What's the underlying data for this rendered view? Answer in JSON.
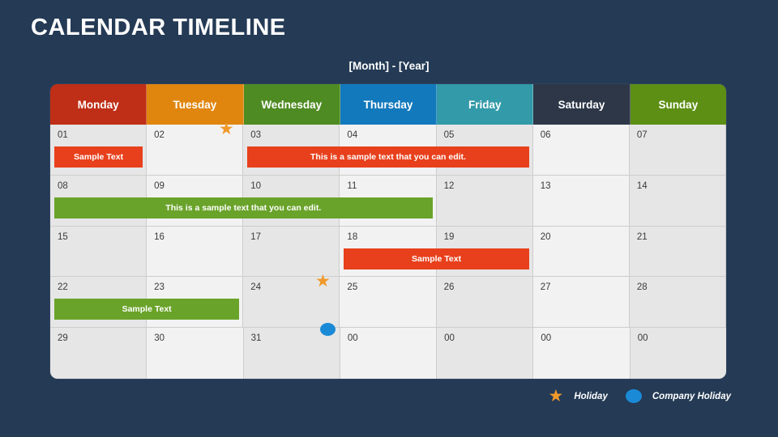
{
  "page": {
    "title": "CALENDAR TIMELINE",
    "subtitle": "[Month] - [Year]",
    "background_color": "#243a55"
  },
  "header": {
    "days": [
      {
        "label": "Monday",
        "color": "#bf2e16"
      },
      {
        "label": "Tuesday",
        "color": "#e0860f"
      },
      {
        "label": "Wednesday",
        "color": "#4e8b22"
      },
      {
        "label": "Thursday",
        "color": "#1379bd"
      },
      {
        "label": "Friday",
        "color": "#329aa8"
      },
      {
        "label": "Saturday",
        "color": "#2d3748"
      },
      {
        "label": "Sunday",
        "color": "#5d8f14"
      }
    ]
  },
  "weeks": [
    {
      "days": [
        "01",
        "02",
        "03",
        "04",
        "05",
        "06",
        "07"
      ],
      "markers": [
        {
          "day_index": 1,
          "type": "star",
          "icon": "star-icon"
        }
      ],
      "events": [
        {
          "text": "Sample Text",
          "start": 0,
          "span": 1,
          "color": "red"
        },
        {
          "text": "This is a sample text that you can edit.",
          "start": 2,
          "span": 3,
          "color": "red"
        }
      ]
    },
    {
      "days": [
        "08",
        "09",
        "10",
        "11",
        "12",
        "13",
        "14"
      ],
      "markers": [],
      "events": [
        {
          "text": "This is a sample text that you can edit.",
          "start": 0,
          "span": 4,
          "color": "green"
        }
      ]
    },
    {
      "days": [
        "15",
        "16",
        "17",
        "18",
        "19",
        "20",
        "21"
      ],
      "markers": [],
      "events": [
        {
          "text": "Sample Text",
          "start": 3,
          "span": 2,
          "color": "red"
        }
      ]
    },
    {
      "days": [
        "22",
        "23",
        "24",
        "25",
        "26",
        "27",
        "28"
      ],
      "markers": [
        {
          "day_index": 2,
          "type": "star",
          "icon": "star-icon"
        }
      ],
      "events": [
        {
          "text": "Sample Text",
          "start": 0,
          "span": 2,
          "color": "green"
        }
      ]
    },
    {
      "days": [
        "29",
        "30",
        "31",
        "00",
        "00",
        "00",
        "00"
      ],
      "markers": [
        {
          "day_index": 2,
          "type": "dot",
          "icon": "circle-icon"
        }
      ],
      "events": []
    }
  ],
  "legend": [
    {
      "icon": "star-icon",
      "label": "Holiday",
      "color": "#f0992a"
    },
    {
      "icon": "circle-icon",
      "label": "Company Holiday",
      "color": "#1b8ad6"
    }
  ]
}
